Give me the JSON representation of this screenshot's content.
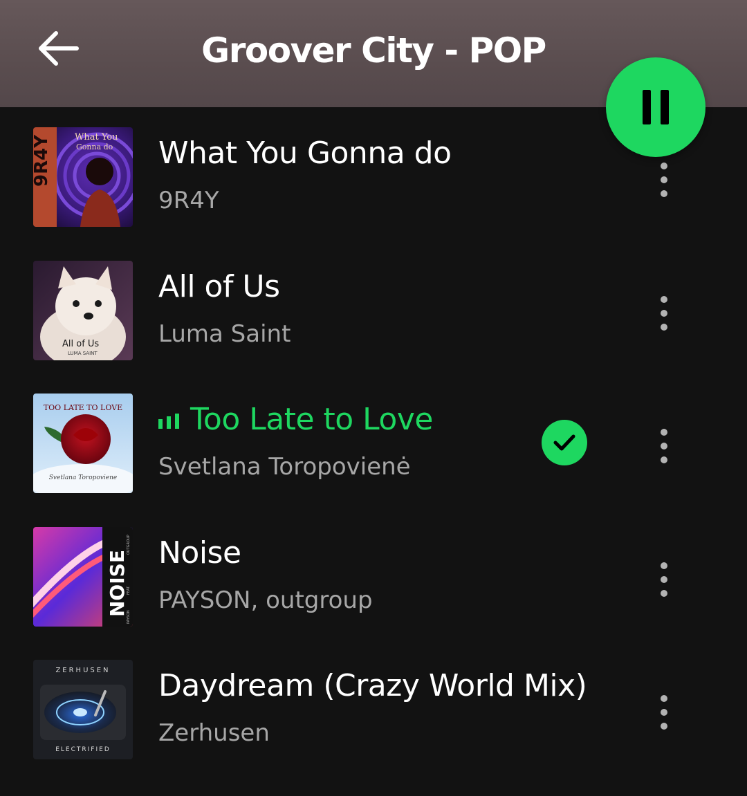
{
  "header": {
    "title": "Groover City - POP",
    "back_icon": "arrow-left-icon",
    "play_state_icon": "pause-icon"
  },
  "colors": {
    "accent": "#1ed760",
    "background": "#121212",
    "header": "#5d5052",
    "secondary_text": "#a7a7a7"
  },
  "tracks": [
    {
      "title": "What You Gonna do",
      "artist": "9R4Y",
      "cover_text_1": "What You",
      "cover_text_2": "Gonna do",
      "cover_side_text": "9R4Y",
      "playing": false,
      "saved": false
    },
    {
      "title": "All of Us",
      "artist": "Luma Saint",
      "cover_text_1": "All of Us",
      "cover_text_2": "LUMA SAINT",
      "playing": false,
      "saved": false
    },
    {
      "title": "Too Late to Love",
      "artist": "Svetlana Toropovienė",
      "cover_text_1": "TOO LATE TO LOVE",
      "cover_text_2": "Svetlana Toropoviene",
      "playing": true,
      "saved": true
    },
    {
      "title": "Noise",
      "artist": "PAYSON, outgroup",
      "cover_text_1": "NOISE",
      "cover_text_2": "PAYSON",
      "cover_text_3": "FEAT.",
      "cover_text_4": "OUTGROUP",
      "playing": false,
      "saved": false
    },
    {
      "title": "Daydream (Crazy World Mix)",
      "artist": "Zerhusen",
      "cover_text_1": "ZERHUSEN",
      "cover_text_2": "ELECTRIFIED",
      "playing": false,
      "saved": false
    }
  ]
}
